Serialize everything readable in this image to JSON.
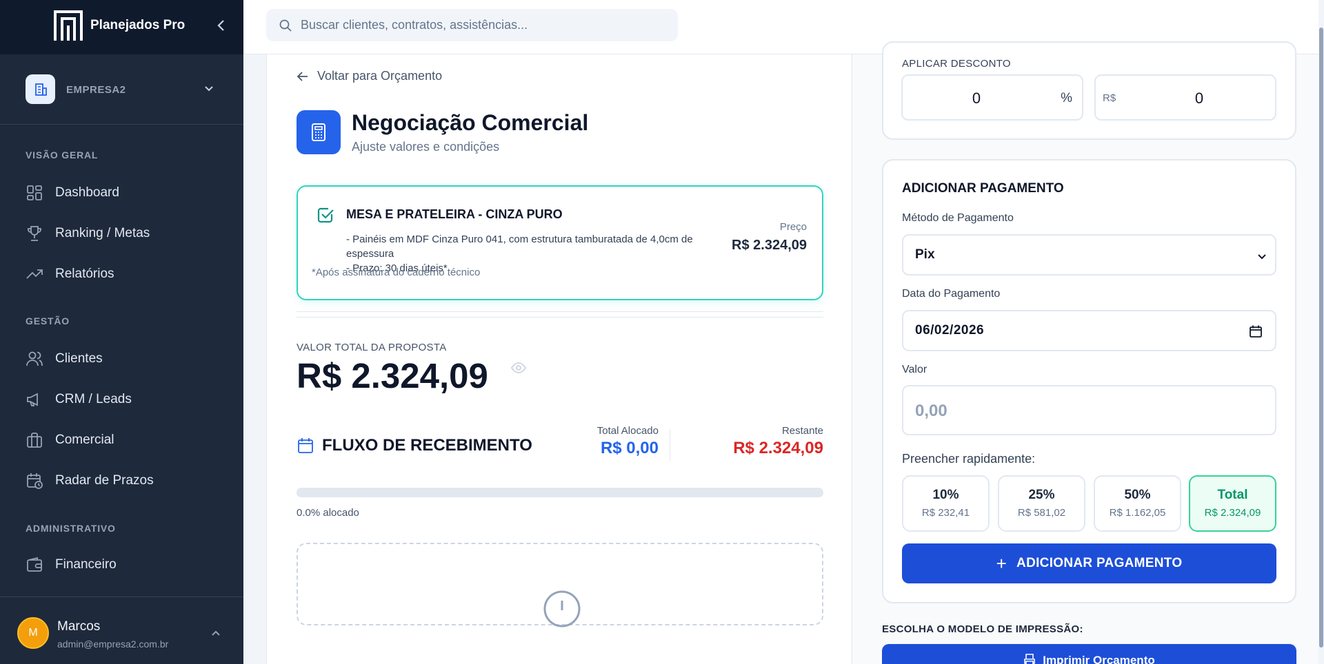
{
  "sidebar": {
    "brand": "Planejados Pro",
    "company": "EMPRESA2",
    "sections": {
      "overview": "VISÃO GERAL",
      "management": "GESTÃO",
      "admin": "ADMINISTRATIVO"
    },
    "items": {
      "dashboard": "Dashboard",
      "ranking": "Ranking / Metas",
      "reports": "Relatórios",
      "clients": "Clientes",
      "crm": "CRM / Leads",
      "commercial": "Comercial",
      "deadlines": "Radar de Prazos",
      "finance": "Financeiro"
    },
    "user": {
      "initial": "M",
      "name": "Marcos",
      "email": "admin@empresa2.com.br"
    }
  },
  "topbar": {
    "search_placeholder": "Buscar clientes, contratos, assistências..."
  },
  "main": {
    "back_label": "Voltar para Orçamento",
    "title": "Negociação Comercial",
    "subtitle": "Ajuste valores e condições",
    "item": {
      "title": "MESA E PRATELEIRA - CINZA PURO",
      "desc_line1": "- Painéis em MDF Cinza Puro 041, com estrutura tamburatada de 4,0cm de espessura",
      "desc_line2": "- Prazo: 30 dias úteis*",
      "price_label": "Preço",
      "price_value": "R$ 2.324,09"
    },
    "note": "*Após assinatura do caderno técnico",
    "total_label": "VALOR TOTAL DA PROPOSTA",
    "total_value": "R$ 2.324,09",
    "flow": {
      "title": "FLUXO DE RECEBIMENTO",
      "allocated_label": "Total Alocado",
      "allocated_value": "R$ 0,00",
      "remaining_label": "Restante",
      "remaining_value": "R$ 2.324,09",
      "progress": 0,
      "progress_text": "0.0% alocado"
    }
  },
  "right": {
    "discount": {
      "label": "APLICAR DESCONTO",
      "percent_value": "0",
      "percent_symbol": "%",
      "currency_symbol": "R$",
      "currency_value": "0"
    },
    "payment": {
      "title": "ADICIONAR PAGAMENTO",
      "method_label": "Método de Pagamento",
      "method_value": "Pix",
      "date_label": "Data do Pagamento",
      "date_value": "06/02/2026",
      "value_label": "Valor",
      "value_placeholder": "0,00",
      "quick_label": "Preencher rapidamente:",
      "quick": [
        {
          "pct": "10%",
          "value": "R$ 232,41"
        },
        {
          "pct": "25%",
          "value": "R$ 581,02"
        },
        {
          "pct": "50%",
          "value": "R$ 1.162,05"
        },
        {
          "pct": "Total",
          "value": "R$ 2.324,09"
        }
      ],
      "add_button": "ADICIONAR PAGAMENTO"
    },
    "print_label": "ESCOLHA O MODELO DE IMPRESSÃO:",
    "print_button": "Imprimir Orçamento"
  },
  "colors": {
    "accent": "#2563eb",
    "success": "#059669",
    "danger": "#dc2626",
    "sidebar_bg": "#1e293b"
  }
}
